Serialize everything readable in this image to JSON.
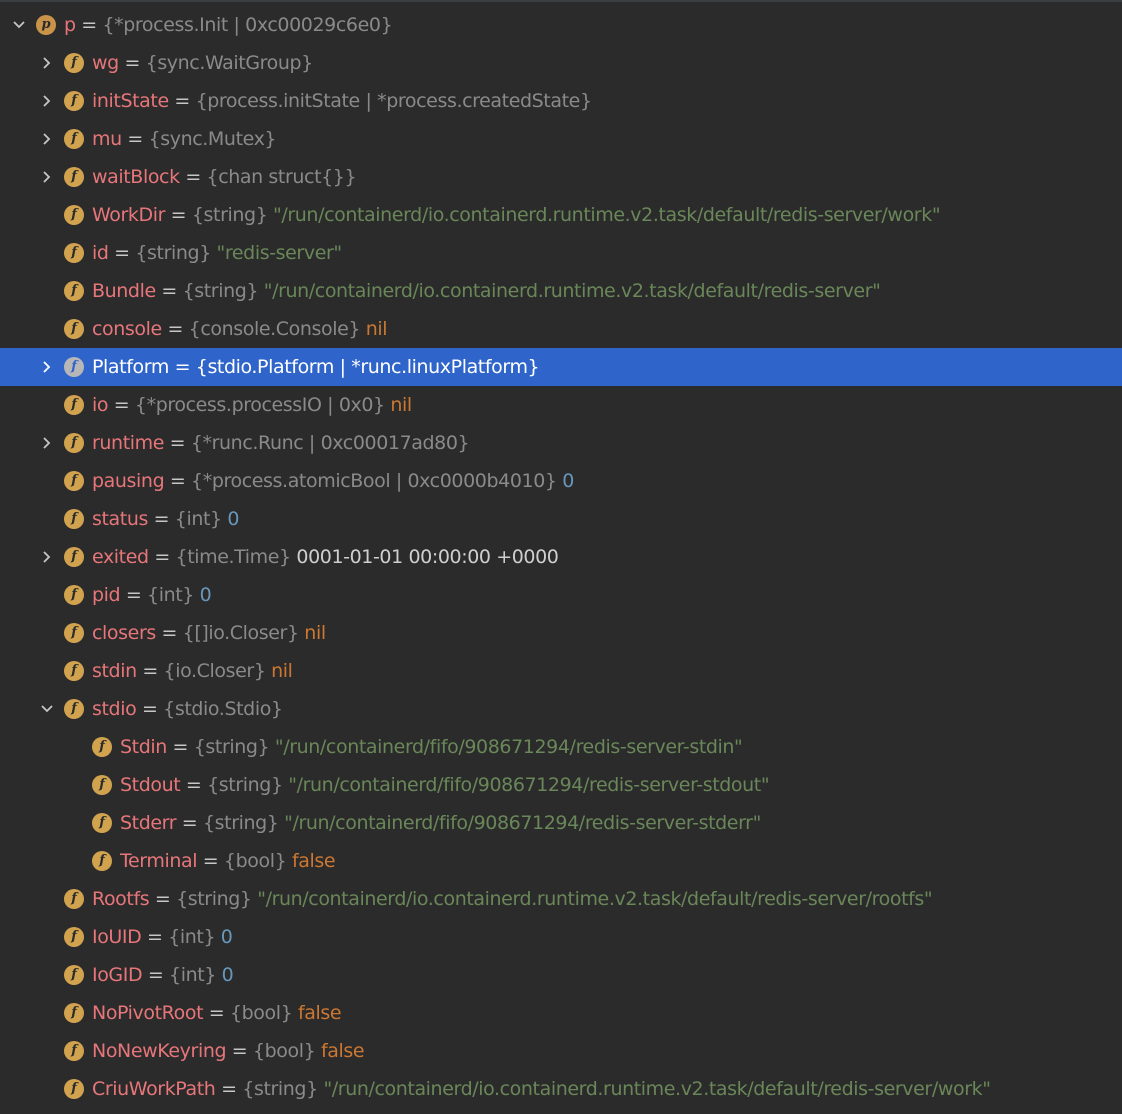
{
  "variables": [
    {
      "depth": 0,
      "arrow": "expanded",
      "icon": "p",
      "name": "p",
      "type": "{*process.Init | 0xc00029c6e0}",
      "value": "",
      "vkind": ""
    },
    {
      "depth": 1,
      "arrow": "collapsed",
      "icon": "f",
      "name": "wg",
      "type": "{sync.WaitGroup}",
      "value": "",
      "vkind": ""
    },
    {
      "depth": 1,
      "arrow": "collapsed",
      "icon": "f",
      "name": "initState",
      "type": "{process.initState | *process.createdState}",
      "value": "",
      "vkind": ""
    },
    {
      "depth": 1,
      "arrow": "collapsed",
      "icon": "f",
      "name": "mu",
      "type": "{sync.Mutex}",
      "value": "",
      "vkind": ""
    },
    {
      "depth": 1,
      "arrow": "collapsed",
      "icon": "f",
      "name": "waitBlock",
      "type": "{chan struct{}}",
      "value": "",
      "vkind": ""
    },
    {
      "depth": 1,
      "arrow": "none",
      "icon": "f",
      "name": "WorkDir",
      "type": "{string}",
      "value": "\"/run/containerd/io.containerd.runtime.v2.task/default/redis-server/work\"",
      "vkind": "str"
    },
    {
      "depth": 1,
      "arrow": "none",
      "icon": "f",
      "name": "id",
      "type": "{string}",
      "value": "\"redis-server\"",
      "vkind": "str"
    },
    {
      "depth": 1,
      "arrow": "none",
      "icon": "f",
      "name": "Bundle",
      "type": "{string}",
      "value": "\"/run/containerd/io.containerd.runtime.v2.task/default/redis-server\"",
      "vkind": "str"
    },
    {
      "depth": 1,
      "arrow": "none",
      "icon": "f",
      "name": "console",
      "type": "{console.Console}",
      "value": "nil",
      "vkind": "kw"
    },
    {
      "depth": 1,
      "arrow": "collapsed",
      "icon": "f",
      "name": "Platform",
      "type": "{stdio.Platform | *runc.linuxPlatform}",
      "value": "",
      "vkind": "",
      "selected": true
    },
    {
      "depth": 1,
      "arrow": "none",
      "icon": "f",
      "name": "io",
      "type": "{*process.processIO | 0x0}",
      "value": "nil",
      "vkind": "kw"
    },
    {
      "depth": 1,
      "arrow": "collapsed",
      "icon": "f",
      "name": "runtime",
      "type": "{*runc.Runc | 0xc00017ad80}",
      "value": "",
      "vkind": ""
    },
    {
      "depth": 1,
      "arrow": "none",
      "icon": "f",
      "name": "pausing",
      "type": "{*process.atomicBool | 0xc0000b4010}",
      "value": "0",
      "vkind": "num"
    },
    {
      "depth": 1,
      "arrow": "none",
      "icon": "f",
      "name": "status",
      "type": "{int}",
      "value": "0",
      "vkind": "num"
    },
    {
      "depth": 1,
      "arrow": "collapsed",
      "icon": "f",
      "name": "exited",
      "type": "{time.Time}",
      "value": "0001-01-01 00:00:00 +0000",
      "vkind": "plain"
    },
    {
      "depth": 1,
      "arrow": "none",
      "icon": "f",
      "name": "pid",
      "type": "{int}",
      "value": "0",
      "vkind": "num"
    },
    {
      "depth": 1,
      "arrow": "none",
      "icon": "f",
      "name": "closers",
      "type": "{[]io.Closer}",
      "value": "nil",
      "vkind": "kw"
    },
    {
      "depth": 1,
      "arrow": "none",
      "icon": "f",
      "name": "stdin",
      "type": "{io.Closer}",
      "value": "nil",
      "vkind": "kw"
    },
    {
      "depth": 1,
      "arrow": "expanded",
      "icon": "f",
      "name": "stdio",
      "type": "{stdio.Stdio}",
      "value": "",
      "vkind": ""
    },
    {
      "depth": 2,
      "arrow": "none",
      "icon": "f",
      "name": "Stdin",
      "type": "{string}",
      "value": "\"/run/containerd/fifo/908671294/redis-server-stdin\"",
      "vkind": "str"
    },
    {
      "depth": 2,
      "arrow": "none",
      "icon": "f",
      "name": "Stdout",
      "type": "{string}",
      "value": "\"/run/containerd/fifo/908671294/redis-server-stdout\"",
      "vkind": "str"
    },
    {
      "depth": 2,
      "arrow": "none",
      "icon": "f",
      "name": "Stderr",
      "type": "{string}",
      "value": "\"/run/containerd/fifo/908671294/redis-server-stderr\"",
      "vkind": "str"
    },
    {
      "depth": 2,
      "arrow": "none",
      "icon": "f",
      "name": "Terminal",
      "type": "{bool}",
      "value": "false",
      "vkind": "kw"
    },
    {
      "depth": 1,
      "arrow": "none",
      "icon": "f",
      "name": "Rootfs",
      "type": "{string}",
      "value": "\"/run/containerd/io.containerd.runtime.v2.task/default/redis-server/rootfs\"",
      "vkind": "str"
    },
    {
      "depth": 1,
      "arrow": "none",
      "icon": "f",
      "name": "IoUID",
      "type": "{int}",
      "value": "0",
      "vkind": "num"
    },
    {
      "depth": 1,
      "arrow": "none",
      "icon": "f",
      "name": "IoGID",
      "type": "{int}",
      "value": "0",
      "vkind": "num"
    },
    {
      "depth": 1,
      "arrow": "none",
      "icon": "f",
      "name": "NoPivotRoot",
      "type": "{bool}",
      "value": "false",
      "vkind": "kw"
    },
    {
      "depth": 1,
      "arrow": "none",
      "icon": "f",
      "name": "NoNewKeyring",
      "type": "{bool}",
      "value": "false",
      "vkind": "kw"
    },
    {
      "depth": 1,
      "arrow": "none",
      "icon": "f",
      "name": "CriuWorkPath",
      "type": "{string}",
      "value": "\"/run/containerd/io.containerd.runtime.v2.task/default/redis-server/work\"",
      "vkind": "str"
    }
  ]
}
